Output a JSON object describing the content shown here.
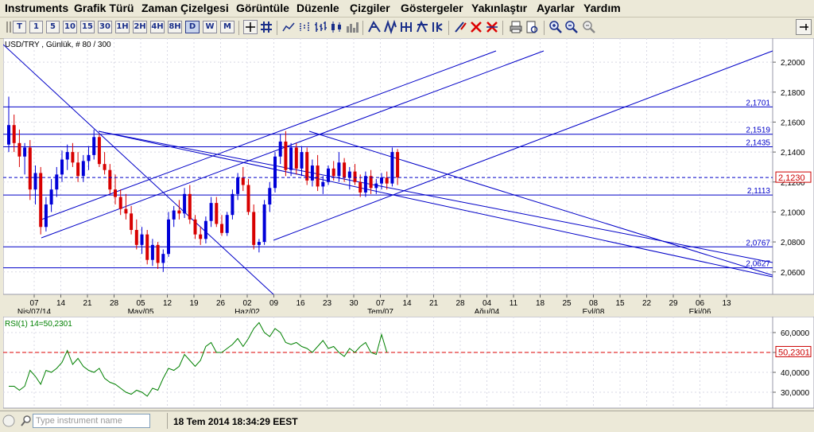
{
  "menu": [
    {
      "id": "instruments",
      "label": "Instruments"
    },
    {
      "id": "chart-type",
      "label": "Grafik Türü"
    },
    {
      "id": "timeline",
      "label": "Zaman Çizelgesi"
    },
    {
      "id": "view",
      "label": "Görüntüle"
    },
    {
      "id": "edit",
      "label": "Düzenle"
    },
    {
      "id": "drawings",
      "label": "Çizgiler"
    },
    {
      "id": "indicators",
      "label": "Göstergeler"
    },
    {
      "id": "zoom",
      "label": "Yakınlaştır"
    },
    {
      "id": "settings",
      "label": "Ayarlar"
    },
    {
      "id": "help",
      "label": "Yardım"
    }
  ],
  "toolbar": {
    "periods": [
      "T",
      "1",
      "5",
      "10",
      "15",
      "30",
      "1H",
      "2H",
      "4H",
      "8H",
      "D",
      "W",
      "M"
    ],
    "active_period": "D",
    "icons": [
      "crosshair-icon",
      "grid-icon",
      "line-chart-icon",
      "dot-chart-icon",
      "bar-chart-icon",
      "candle-chart-icon",
      "volume-chart-icon",
      "fork-icon",
      "fork-alt-icon",
      "fork-multi-icon",
      "fork-flag-icon",
      "edit-draw-icon",
      "delete-drawing-icon",
      "delete-all-icon",
      "print-icon",
      "page-setup-icon",
      "zoom-in-icon",
      "zoom-out-icon",
      "zoom-reset-icon",
      "pin-icon"
    ]
  },
  "chart_header": "USD/TRY , Günlük, # 80 / 300",
  "chart_data": [
    {
      "type": "candlestick",
      "title": "USD/TRY , Günlük, # 80 / 300",
      "y_range": [
        2.045,
        2.216
      ],
      "y_ticks": [
        "2,2000",
        "2,1800",
        "2,1600",
        "2,1400",
        "2,1200",
        "2,1000",
        "2,0800",
        "2,0600"
      ],
      "last_price": "2,1230",
      "x_ticks": [
        "07",
        "14",
        "21",
        "28",
        "05",
        "12",
        "19",
        "26",
        "02",
        "09",
        "16",
        "23",
        "30",
        "07",
        "14",
        "21",
        "28",
        "04",
        "11",
        "18",
        "25",
        "08",
        "15",
        "22",
        "29",
        "06",
        "13"
      ],
      "x_month_labels": [
        "Nis/07/14",
        "May/05",
        "Haz/02",
        "Tem/07",
        "Ağu/04",
        "Eyl/08",
        "Eki/06"
      ],
      "levels": [
        {
          "label": "2,1701",
          "value": 2.1701
        },
        {
          "label": "2,1519",
          "value": 2.1519
        },
        {
          "label": "2,1435",
          "value": 2.1435
        },
        {
          "label": "2,1113",
          "value": 2.1113
        },
        {
          "label": "2,0767",
          "value": 2.0767
        },
        {
          "label": "2,0627",
          "value": 2.0627
        }
      ],
      "candles_ohlc": [
        [
          2.145,
          2.177,
          2.14,
          2.158
        ],
        [
          2.158,
          2.165,
          2.14,
          2.146
        ],
        [
          2.146,
          2.155,
          2.13,
          2.137
        ],
        [
          2.137,
          2.146,
          2.125,
          2.143
        ],
        [
          2.143,
          2.148,
          2.108,
          2.115
        ],
        [
          2.115,
          2.131,
          2.105,
          2.126
        ],
        [
          2.126,
          2.13,
          2.085,
          2.09
        ],
        [
          2.09,
          2.11,
          2.087,
          2.105
        ],
        [
          2.105,
          2.122,
          2.1,
          2.115
        ],
        [
          2.115,
          2.13,
          2.11,
          2.125
        ],
        [
          2.125,
          2.141,
          2.12,
          2.135
        ],
        [
          2.135,
          2.145,
          2.128,
          2.14
        ],
        [
          2.14,
          2.146,
          2.13,
          2.133
        ],
        [
          2.133,
          2.14,
          2.12,
          2.124
        ],
        [
          2.124,
          2.138,
          2.12,
          2.134
        ],
        [
          2.134,
          2.144,
          2.128,
          2.138
        ],
        [
          2.138,
          2.155,
          2.135,
          2.15
        ],
        [
          2.15,
          2.152,
          2.13,
          2.132
        ],
        [
          2.132,
          2.14,
          2.125,
          2.128
        ],
        [
          2.128,
          2.132,
          2.112,
          2.115
        ],
        [
          2.115,
          2.125,
          2.105,
          2.11
        ],
        [
          2.11,
          2.115,
          2.098,
          2.102
        ],
        [
          2.102,
          2.112,
          2.095,
          2.099
        ],
        [
          2.099,
          2.104,
          2.085,
          2.088
        ],
        [
          2.088,
          2.095,
          2.075,
          2.078
        ],
        [
          2.078,
          2.09,
          2.072,
          2.085
        ],
        [
          2.085,
          2.088,
          2.065,
          2.068
        ],
        [
          2.068,
          2.082,
          2.064,
          2.078
        ],
        [
          2.078,
          2.08,
          2.062,
          2.066
        ],
        [
          2.066,
          2.075,
          2.06,
          2.072
        ],
        [
          2.072,
          2.1,
          2.07,
          2.095
        ],
        [
          2.095,
          2.104,
          2.09,
          2.101
        ],
        [
          2.101,
          2.108,
          2.095,
          2.099
        ],
        [
          2.099,
          2.116,
          2.096,
          2.112
        ],
        [
          2.112,
          2.118,
          2.092,
          2.095
        ],
        [
          2.095,
          2.098,
          2.082,
          2.085
        ],
        [
          2.085,
          2.09,
          2.078,
          2.082
        ],
        [
          2.082,
          2.097,
          2.079,
          2.094
        ],
        [
          2.094,
          2.11,
          2.09,
          2.106
        ],
        [
          2.106,
          2.11,
          2.09,
          2.092
        ],
        [
          2.092,
          2.098,
          2.084,
          2.086
        ],
        [
          2.086,
          2.1,
          2.084,
          2.098
        ],
        [
          2.098,
          2.115,
          2.095,
          2.112
        ],
        [
          2.112,
          2.126,
          2.108,
          2.123
        ],
        [
          2.123,
          2.13,
          2.114,
          2.118
        ],
        [
          2.118,
          2.122,
          2.098,
          2.1
        ],
        [
          2.1,
          2.105,
          2.075,
          2.078
        ],
        [
          2.078,
          2.082,
          2.073,
          2.08
        ],
        [
          2.08,
          2.108,
          2.078,
          2.105
        ],
        [
          2.105,
          2.12,
          2.1,
          2.116
        ],
        [
          2.116,
          2.14,
          2.113,
          2.137
        ],
        [
          2.137,
          2.152,
          2.132,
          2.147
        ],
        [
          2.147,
          2.154,
          2.124,
          2.128
        ],
        [
          2.128,
          2.146,
          2.124,
          2.143
        ],
        [
          2.143,
          2.146,
          2.125,
          2.129
        ],
        [
          2.129,
          2.144,
          2.124,
          2.14
        ],
        [
          2.14,
          2.143,
          2.118,
          2.121
        ],
        [
          2.121,
          2.135,
          2.117,
          2.131
        ],
        [
          2.131,
          2.138,
          2.114,
          2.117
        ],
        [
          2.117,
          2.124,
          2.112,
          2.12
        ],
        [
          2.12,
          2.131,
          2.118,
          2.129
        ],
        [
          2.129,
          2.134,
          2.121,
          2.124
        ],
        [
          2.124,
          2.14,
          2.12,
          2.133
        ],
        [
          2.133,
          2.136,
          2.12,
          2.123
        ],
        [
          2.123,
          2.13,
          2.115,
          2.127
        ],
        [
          2.127,
          2.132,
          2.118,
          2.12
        ],
        [
          2.12,
          2.125,
          2.11,
          2.113
        ],
        [
          2.113,
          2.127,
          2.11,
          2.124
        ],
        [
          2.124,
          2.128,
          2.112,
          2.116
        ],
        [
          2.116,
          2.122,
          2.112,
          2.119
        ],
        [
          2.119,
          2.126,
          2.115,
          2.123
        ],
        [
          2.123,
          2.127,
          2.115,
          2.119
        ],
        [
          2.119,
          2.143,
          2.117,
          2.14
        ],
        [
          2.14,
          2.142,
          2.118,
          2.123
        ]
      ]
    },
    {
      "type": "line",
      "title": "RSI(1) 14=50,2301",
      "y_range": [
        22,
        68
      ],
      "y_ticks": [
        "60,0000",
        "50,0000",
        "40,0000",
        "30,0000"
      ],
      "last_value_label": "50,2301",
      "reference_line": 50,
      "values": [
        33,
        33,
        31,
        33,
        41,
        38,
        34,
        41,
        40,
        42,
        45,
        51,
        44,
        47,
        43,
        41,
        40,
        42,
        37,
        35,
        34,
        32,
        30,
        29,
        31,
        30,
        28,
        32,
        31,
        37,
        42,
        41,
        43,
        49,
        46,
        43,
        46,
        53,
        55,
        50,
        50,
        52,
        54,
        57,
        53,
        57,
        62,
        65,
        60,
        58,
        62,
        60,
        55,
        54,
        55,
        53,
        52,
        50,
        53,
        56,
        52,
        53,
        50,
        48,
        52,
        50,
        53,
        55,
        50,
        49,
        59,
        50
      ]
    }
  ],
  "status": {
    "search_placeholder": "Type instrument name",
    "datetime": "18 Tem 2014 18:34:29 EEST"
  }
}
